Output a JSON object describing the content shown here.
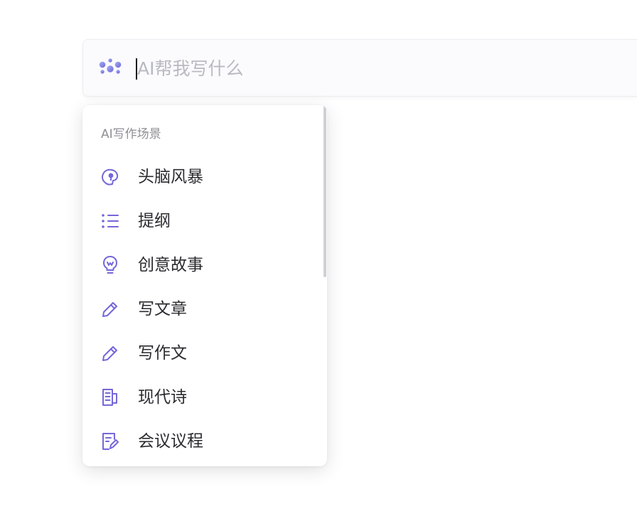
{
  "input": {
    "placeholder": "AI帮我写什么",
    "value": "",
    "icon": "ai-sparkle-icon"
  },
  "menu": {
    "heading": "AI写作场景",
    "accent_color": "#7467d9",
    "items": [
      {
        "label": "头脑风暴",
        "icon": "brain-icon"
      },
      {
        "label": "提纲",
        "icon": "outline-list-icon"
      },
      {
        "label": "创意故事",
        "icon": "lightbulb-icon"
      },
      {
        "label": "写文章",
        "icon": "pencil-icon"
      },
      {
        "label": "写作文",
        "icon": "pencil-icon"
      },
      {
        "label": "现代诗",
        "icon": "poem-book-icon"
      },
      {
        "label": "会议议程",
        "icon": "agenda-edit-icon"
      }
    ]
  }
}
